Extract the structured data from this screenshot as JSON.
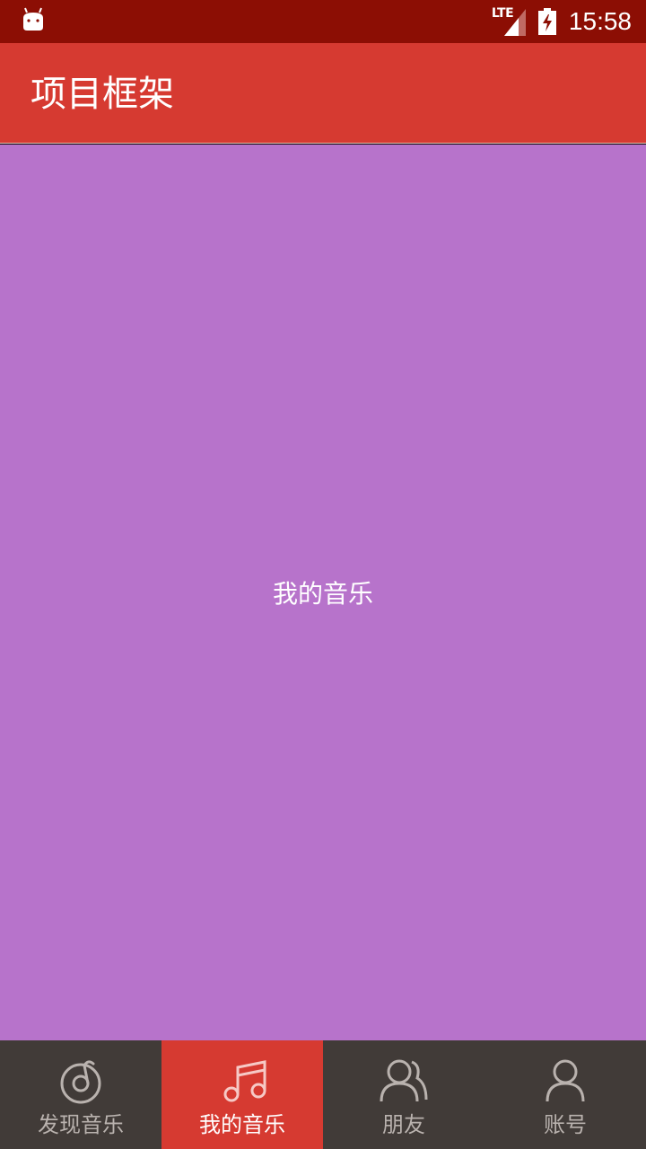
{
  "status_bar": {
    "network": "LTE",
    "time": "15:58",
    "icons": [
      "android-debug-icon",
      "signal-icon",
      "battery-charging-icon"
    ]
  },
  "app_bar": {
    "title": "项目框架"
  },
  "content": {
    "text": "我的音乐"
  },
  "bottom_nav": {
    "items": [
      {
        "label": "发现音乐",
        "icon": "discover-music-icon",
        "active": false
      },
      {
        "label": "我的音乐",
        "icon": "music-note-icon",
        "active": true
      },
      {
        "label": "朋友",
        "icon": "friends-icon",
        "active": false
      },
      {
        "label": "账号",
        "icon": "account-icon",
        "active": false
      }
    ]
  },
  "colors": {
    "status_bar": "#8c0e04",
    "primary": "#d63a31",
    "content_bg": "#b773cb",
    "nav_bg": "#413b38",
    "nav_inactive": "#b9b2ae"
  }
}
